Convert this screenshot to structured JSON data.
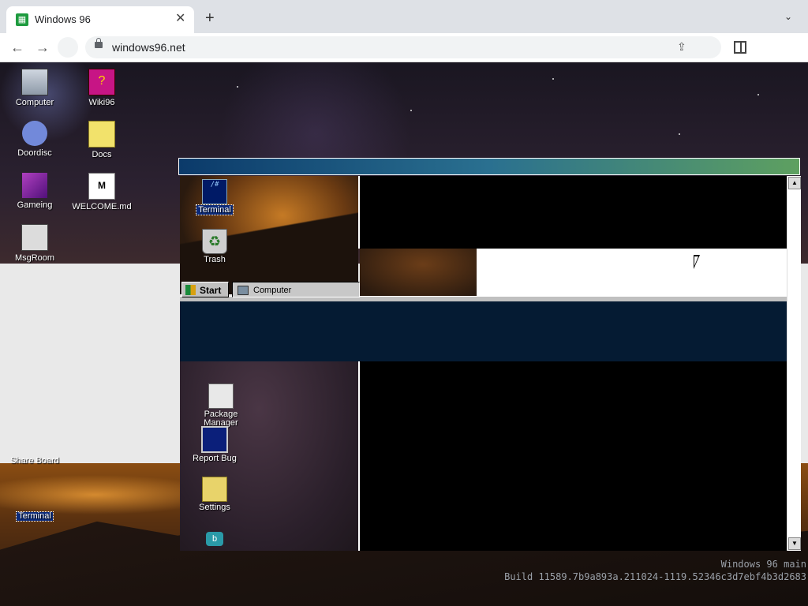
{
  "browser": {
    "tab_title": "Windows 96",
    "tab_close": "✕",
    "new_tab": "+",
    "tab_menu": "⌄",
    "back": "←",
    "forward": "→",
    "url": "windows96.net",
    "share_icon": "⇪"
  },
  "desktop": {
    "icons": [
      {
        "label": "Computer",
        "icon": "computer-icon"
      },
      {
        "label": "Wiki96",
        "icon": "book-icon"
      },
      {
        "label": "Doordisc",
        "icon": "discord-icon"
      },
      {
        "label": "Docs",
        "icon": "folder-icon"
      },
      {
        "label": "Gameing",
        "icon": "cube-icon"
      },
      {
        "label": "WELCOME.md",
        "icon": "markdown-icon"
      },
      {
        "label": "MsgRoom",
        "icon": "msgroom-icon"
      }
    ],
    "lower_icon_partial": "Share Board",
    "lower_terminal_label": "Terminal",
    "watermark_line1": "Windows 96 main",
    "watermark_line2": "Build 11589.7b9a893a.211024-1119.52346c3d7ebf4b3d2683"
  },
  "window": {
    "icons": [
      {
        "label": "Terminal",
        "icon": "terminal-icon",
        "glyph": "/#"
      },
      {
        "label": "Trash",
        "icon": "trash-icon",
        "glyph": "♻"
      },
      {
        "label": "Package Manager",
        "icon": "package-manager-icon",
        "glyph": ""
      },
      {
        "label": "Report Bug",
        "icon": "report-bug-icon",
        "glyph": ""
      },
      {
        "label": "Settings",
        "icon": "settings-icon",
        "glyph": ""
      },
      {
        "label": "",
        "icon": "app-icon",
        "glyph": "b"
      }
    ],
    "start_label": "Start",
    "taskbar_item": "Computer",
    "scroll_up": "▲",
    "scroll_down": "▼"
  },
  "colors": {
    "titlebar_start": "#0b3a6a",
    "titlebar_end": "#5ea060",
    "selection": "#0b2a7a"
  }
}
